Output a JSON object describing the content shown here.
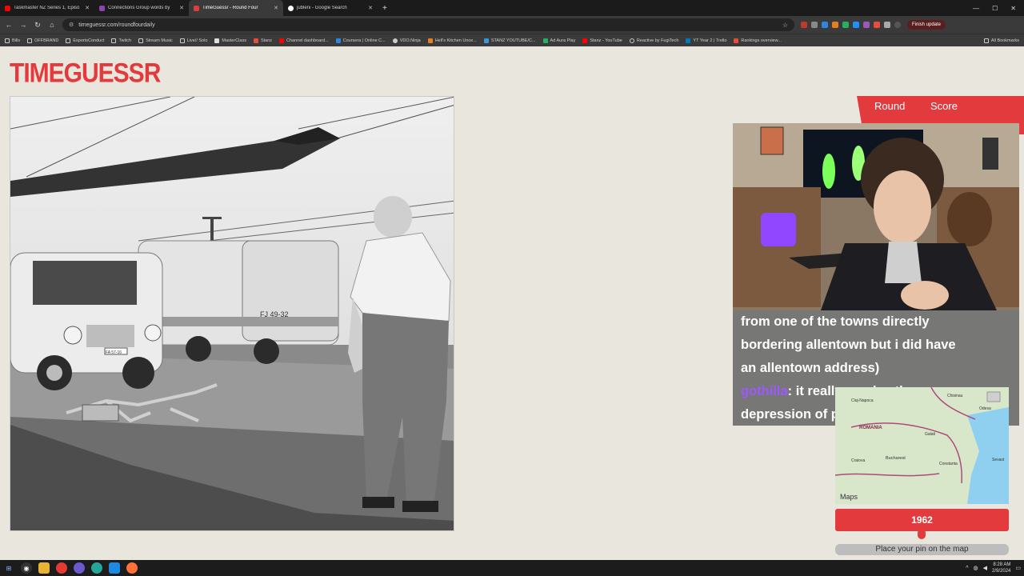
{
  "browser": {
    "tabs": [
      {
        "title": "Taskmaster NZ Series 1, Episo",
        "color": "#ff0000",
        "active": false
      },
      {
        "title": "Connections Group words by ",
        "color": "#8e44ad",
        "active": false
      },
      {
        "title": "TimeGuessr - Round Four",
        "color": "#e33a3e",
        "active": true
      },
      {
        "title": "jubleni - Google Search",
        "color": "#ffffff",
        "active": false
      }
    ],
    "new_tab": "+",
    "url": "timeguessr.com/roundfourdaily",
    "finish_update": "Finish update",
    "bookmarks": [
      "Bills",
      "OFFBRAND",
      "EsportsConduct",
      "Twitch",
      "Stream Music",
      "Live// Solo",
      "MasterClass",
      "Stanz",
      "Channel dashboard...",
      "Coursera | Online C...",
      "VDO.Ninja",
      "Hell's Kitchen Unce...",
      "STANZ YOUTUBE/C...",
      "Ad Aura Play",
      "Stanz - YouTube",
      "Reactive by FugiTech",
      "YT Year 2 | Trello",
      "Rankings overview..."
    ],
    "all_bookmarks": "All Bookmarks"
  },
  "page": {
    "logo": "TIMEGUESSR",
    "round_label": "Round",
    "score_label": "Score",
    "photo_van_text_1": "FJ 49-32",
    "photo_van_text_2": "FA 57-16"
  },
  "chat": {
    "lines": [
      "from one of the towns directly",
      "bordering allentown but i did have",
      "an allentown address)"
    ],
    "user": "gothilla",
    "message_line1": " it really exudes the",
    "message_line2": "depression of poland"
  },
  "map": {
    "labels": [
      "ROMANIA",
      "Bucharest",
      "Craiova",
      "Constanta",
      "Odesa",
      "Chisinau",
      "Galati",
      "Sevast",
      "Cluj-Napoca"
    ],
    "attribution": "Maps"
  },
  "guess": {
    "year": "1962",
    "pin_prompt": "Place your pin on the map"
  },
  "taskbar": {
    "time": "8:28 AM",
    "date": "2/9/2024"
  },
  "colors": {
    "accent": "#e33a3e",
    "page_bg": "#e9e7dd"
  }
}
